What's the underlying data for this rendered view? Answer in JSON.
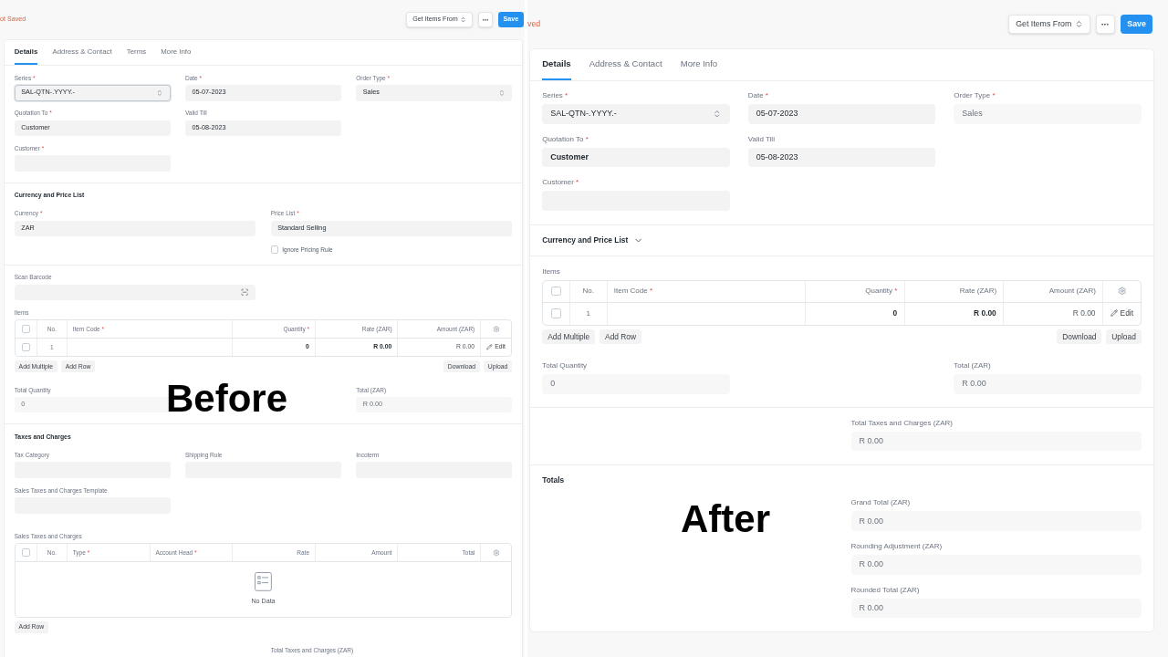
{
  "panels": [
    {
      "caption": "Before",
      "status": "ot Saved",
      "actions": [
        {
          "kind": "dropdown",
          "label": "Get Items From"
        },
        {
          "kind": "more"
        },
        {
          "kind": "primary",
          "label": "Save"
        }
      ],
      "tabs": [
        {
          "label": "Details",
          "selected": true
        },
        {
          "label": "Address & Contact",
          "selected": false
        },
        {
          "label": "Terms",
          "selected": false
        },
        {
          "label": "More Info",
          "selected": false
        }
      ],
      "sections": [
        {
          "rows": [
            {
              "kind": "grid",
              "columns": [
                [
                  {
                    "kind": "select",
                    "label": "Series",
                    "mark": "*",
                    "value": "SAL-QTN-.YYYY.-",
                    "focused": true
                  },
                  {
                    "kind": "input",
                    "label": "Quotation To",
                    "mark": "*",
                    "value": "Customer"
                  },
                  {
                    "kind": "input",
                    "label": "Customer",
                    "mark": "*"
                  }
                ],
                [
                  {
                    "kind": "input",
                    "label": "Date",
                    "mark": "*",
                    "value": "05-07-2023"
                  },
                  {
                    "kind": "input",
                    "label": "Valid Till",
                    "value": "05-08-2023"
                  }
                ],
                [
                  {
                    "kind": "select",
                    "label": "Order Type",
                    "mark": "*",
                    "value": "Sales"
                  }
                ]
              ]
            }
          ]
        },
        {
          "title": "Currency and Price List",
          "rows": [
            {
              "kind": "grid",
              "columns": [
                [
                  {
                    "kind": "input",
                    "label": "Currency",
                    "mark": "*",
                    "value": "ZAR"
                  }
                ],
                [
                  {
                    "kind": "input",
                    "label": "Price List",
                    "mark": "*",
                    "value": "Standard Selling"
                  },
                  {
                    "kind": "checkbox",
                    "label": "Ignore Pricing Rule",
                    "checked": false
                  }
                ]
              ]
            }
          ]
        },
        {
          "rows": [
            {
              "kind": "left_half",
              "fields": [
                {
                  "kind": "barcode",
                  "label": "Scan Barcode"
                }
              ]
            },
            {
              "kind": "table",
              "label": "Items",
              "number_label": "No.",
              "all_checked": false,
              "columns": [
                {
                  "kind": "text",
                  "label": "Item Code",
                  "mark": "*"
                },
                {
                  "kind": "number",
                  "label": "Quantity",
                  "mark": "*"
                },
                {
                  "kind": "number",
                  "label": "Rate (ZAR)"
                },
                {
                  "kind": "number",
                  "label": "Amount (ZAR)"
                }
              ],
              "rows": [
                {
                  "checked": false,
                  "no": "1",
                  "cells": [
                    {
                      "kind": "empty"
                    },
                    {
                      "kind": "strong",
                      "value": "0"
                    },
                    {
                      "kind": "strong",
                      "value": "R 0.00"
                    },
                    {
                      "kind": "plain",
                      "value": "R 0.00"
                    }
                  ],
                  "action": "Edit"
                }
              ],
              "start_actions": [
                "Add Multiple",
                "Add Row"
              ],
              "end_actions": [
                "Download",
                "Upload"
              ]
            },
            {
              "kind": "edges",
              "start": [
                {
                  "kind": "readonly",
                  "label": "Total Quantity",
                  "value": "0"
                }
              ],
              "end": [
                {
                  "kind": "readonly",
                  "label": "Total (ZAR)",
                  "value": "R 0.00"
                }
              ]
            }
          ]
        },
        {
          "title": "Taxes and Charges",
          "rows": [
            {
              "kind": "grid",
              "columns": [
                [
                  {
                    "kind": "input",
                    "label": "Tax Category"
                  },
                  {
                    "kind": "input",
                    "label": "Sales Taxes and Charges Template"
                  }
                ],
                [
                  {
                    "kind": "input",
                    "label": "Shipping Rule"
                  }
                ],
                [
                  {
                    "kind": "input",
                    "label": "Incoterm"
                  }
                ]
              ]
            },
            {
              "kind": "table",
              "label": "Sales Taxes and Charges",
              "number_label": "No.",
              "all_checked": false,
              "columns": [
                {
                  "kind": "text",
                  "label": "Type",
                  "mark": "*"
                },
                {
                  "kind": "text",
                  "label": "Account Head",
                  "mark": "*"
                },
                {
                  "kind": "number",
                  "label": "Rate"
                },
                {
                  "kind": "number",
                  "label": "Amount"
                },
                {
                  "kind": "number",
                  "label": "Total"
                }
              ],
              "empty_text": "No Data",
              "start_actions": [
                "Add Row"
              ]
            },
            {
              "kind": "right_half",
              "fields": [
                {
                  "kind": "label",
                  "label": "Total Taxes and Charges (ZAR)"
                }
              ]
            }
          ]
        }
      ]
    },
    {
      "caption": "After",
      "status": "ved",
      "actions": [
        {
          "kind": "dropdown",
          "label": "Get Items From"
        },
        {
          "kind": "more"
        },
        {
          "kind": "primary",
          "label": "Save"
        }
      ],
      "tabs": [
        {
          "label": "Details",
          "selected": true
        },
        {
          "label": "Address & Contact",
          "selected": false
        },
        {
          "label": "More Info",
          "selected": false
        }
      ],
      "sections": [
        {
          "rows": [
            {
              "kind": "grid",
              "columns": [
                [
                  {
                    "kind": "select",
                    "label": "Series",
                    "mark": "*",
                    "value": "SAL-QTN-.YYYY.-",
                    "focused": false
                  },
                  {
                    "kind": "input",
                    "label": "Quotation To",
                    "mark": "*",
                    "value": "Customer",
                    "strong": true
                  },
                  {
                    "kind": "input",
                    "label": "Customer",
                    "mark": "*"
                  }
                ],
                [
                  {
                    "kind": "input",
                    "label": "Date",
                    "mark": "*",
                    "value": "05-07-2023"
                  },
                  {
                    "kind": "input",
                    "label": "Valid Till",
                    "value": "05-08-2023"
                  }
                ],
                [
                  {
                    "kind": "readonly",
                    "label": "Order Type",
                    "mark": "*",
                    "value": "Sales"
                  }
                ]
              ]
            }
          ]
        },
        {
          "title": "Currency and Price List",
          "collapsible": true,
          "expanded": false
        },
        {
          "rows": [
            {
              "kind": "table",
              "label": "Items",
              "number_label": "No.",
              "all_checked": false,
              "columns": [
                {
                  "kind": "text",
                  "label": "Item Code",
                  "mark": "*"
                },
                {
                  "kind": "number",
                  "label": "Quantity",
                  "mark": "*"
                },
                {
                  "kind": "number",
                  "label": "Rate (ZAR)"
                },
                {
                  "kind": "number",
                  "label": "Amount (ZAR)"
                }
              ],
              "rows": [
                {
                  "checked": false,
                  "no": "1",
                  "cells": [
                    {
                      "kind": "empty"
                    },
                    {
                      "kind": "strong",
                      "value": "0"
                    },
                    {
                      "kind": "strong",
                      "value": "R 0.00"
                    },
                    {
                      "kind": "plain",
                      "value": "R 0.00"
                    }
                  ],
                  "action": "Edit"
                }
              ],
              "start_actions": [
                "Add Multiple",
                "Add Row"
              ],
              "end_actions": [
                "Download",
                "Upload"
              ]
            },
            {
              "kind": "edges",
              "start": [
                {
                  "kind": "readonly",
                  "label": "Total Quantity",
                  "value": "0"
                }
              ],
              "end": [
                {
                  "kind": "readonly",
                  "label": "Total (ZAR)",
                  "value": "R 0.00"
                }
              ]
            }
          ]
        },
        {
          "rows": [
            {
              "kind": "right_half",
              "fields": [
                {
                  "kind": "readonly",
                  "label": "Total Taxes and Charges (ZAR)",
                  "value": "R 0.00"
                }
              ]
            }
          ]
        },
        {
          "title": "Totals",
          "rows": [
            {
              "kind": "right_half",
              "fields": [
                {
                  "kind": "readonly",
                  "label": "Grand Total (ZAR)",
                  "value": "R 0.00"
                },
                {
                  "kind": "readonly",
                  "label": "Rounding Adjustment (ZAR)",
                  "value": "R 0.00"
                },
                {
                  "kind": "readonly",
                  "label": "Rounded Total (ZAR)",
                  "value": "R 0.00"
                }
              ]
            }
          ]
        }
      ]
    }
  ]
}
